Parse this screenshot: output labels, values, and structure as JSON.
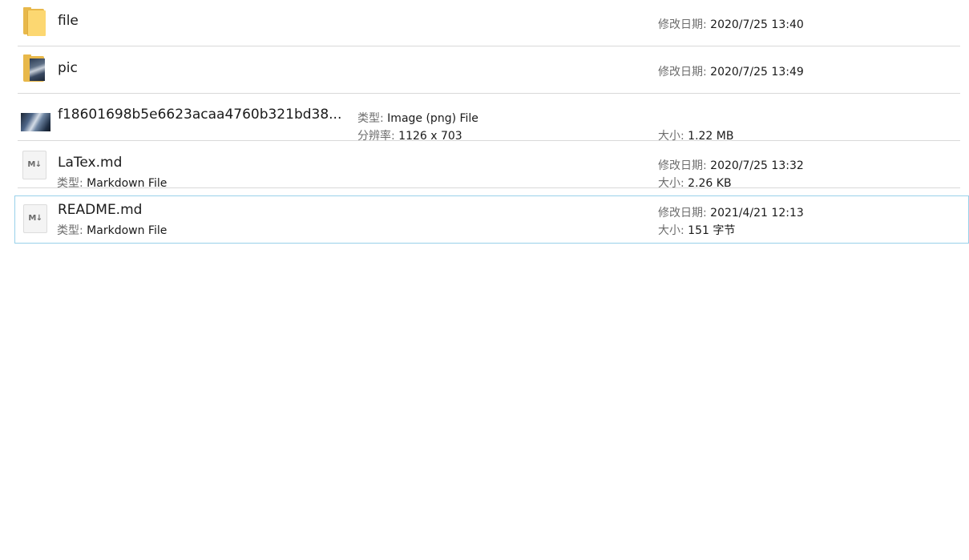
{
  "labels": {
    "modified": "修改日期:",
    "type": "类型:",
    "size": "大小:",
    "resolution": "分辨率:"
  },
  "items": [
    {
      "name": "file",
      "icon": "folder-icon",
      "modified": "2020/7/25 13:40"
    },
    {
      "name": "pic",
      "icon": "folder-image-icon",
      "modified": "2020/7/25 13:49"
    },
    {
      "name": "f18601698b5e6623acaa4760b321bd38...",
      "icon": "image-thumbnail-icon",
      "type": "Image (png) File",
      "resolution": "1126 x 703",
      "size": "1.22 MB"
    },
    {
      "name": "LaTex.md",
      "icon": "markdown-file-icon",
      "type": "Markdown File",
      "modified": "2020/7/25 13:32",
      "size": "2.26 KB"
    },
    {
      "name": "README.md",
      "icon": "markdown-file-icon",
      "type": "Markdown File",
      "modified": "2021/4/21 12:13",
      "size": "151 字节",
      "selected": true
    }
  ],
  "md_icon_text": "M↓",
  "colors": {
    "selection_border": "#99d1ea",
    "separator": "#d9d9d9",
    "folder": "#fcd771"
  }
}
